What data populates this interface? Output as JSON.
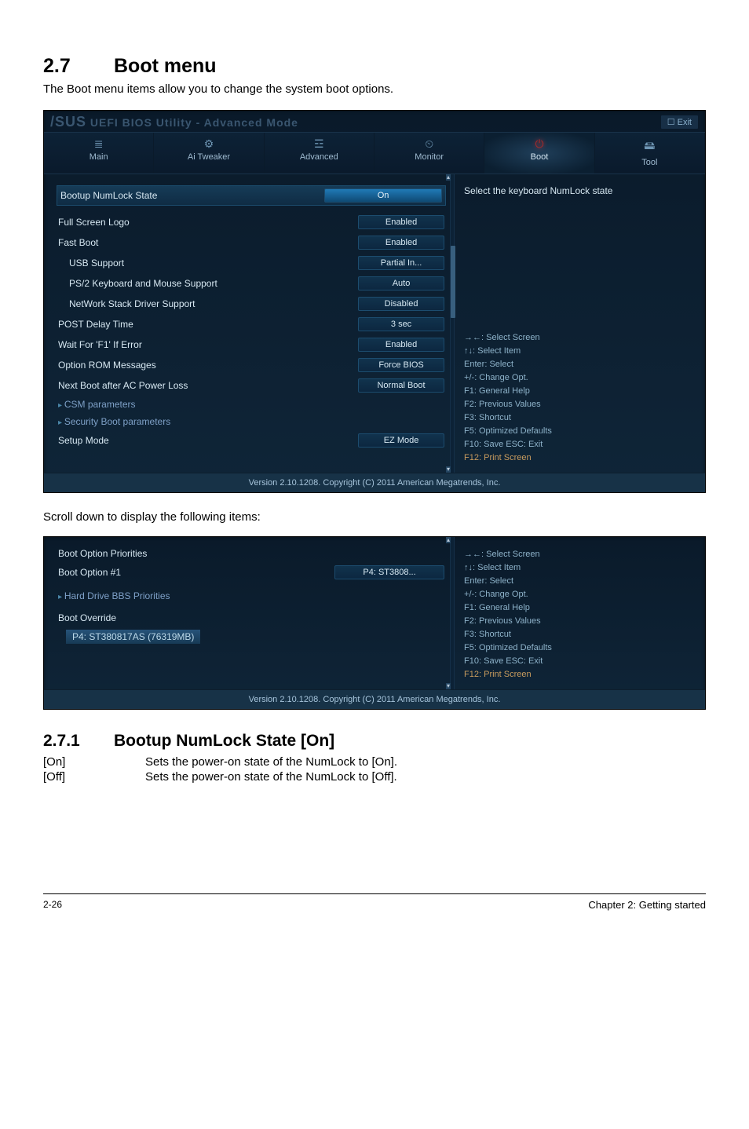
{
  "section": {
    "num": "2.7",
    "title": "Boot menu"
  },
  "intro": "The Boot menu items allow you to change the system boot options.",
  "bios1": {
    "brand_prefix": "/SUS",
    "brand_rest": " UEFI BIOS Utility - Advanced Mode",
    "exit": "Exit",
    "tabs": [
      {
        "icon": "≣",
        "label": "Main"
      },
      {
        "icon": "⚙",
        "label": "Ai Tweaker"
      },
      {
        "icon": "☲",
        "label": "Advanced"
      },
      {
        "icon": "⏲",
        "label": "Monitor"
      },
      {
        "icon": "⏻",
        "label": "Boot"
      },
      {
        "icon": "🖴",
        "label": "Tool"
      }
    ],
    "rows": {
      "numlock": {
        "label": "Bootup NumLock State",
        "value": "On"
      },
      "fullscreen": {
        "label": "Full Screen Logo",
        "value": "Enabled"
      },
      "fastboot": {
        "label": "Fast Boot",
        "value": "Enabled"
      },
      "usb": {
        "label": "USB Support",
        "value": "Partial In..."
      },
      "ps2": {
        "label": "PS/2 Keyboard and Mouse Support",
        "value": "Auto"
      },
      "netstack": {
        "label": "NetWork Stack Driver Support",
        "value": "Disabled"
      },
      "postdelay": {
        "label": "POST Delay Time",
        "value": "3 sec"
      },
      "waitf1": {
        "label": "Wait For 'F1' If Error",
        "value": "Enabled"
      },
      "optrom": {
        "label": "Option ROM Messages",
        "value": "Force BIOS"
      },
      "nextboot": {
        "label": "Next Boot after AC Power Loss",
        "value": "Normal Boot"
      },
      "csm": {
        "label": "CSM parameters"
      },
      "security": {
        "label": "Security Boot parameters"
      },
      "setupmode": {
        "label": "Setup Mode",
        "value": "EZ Mode"
      }
    },
    "right_desc": "Select the keyboard NumLock state",
    "help": {
      "l1": "→←: Select Screen",
      "l2": "↑↓: Select Item",
      "l3": "Enter: Select",
      "l4": "+/-: Change Opt.",
      "l5": "F1: General Help",
      "l6": "F2: Previous Values",
      "l7": "F3: Shortcut",
      "l8": "F5: Optimized Defaults",
      "l9": "F10: Save   ESC: Exit",
      "l10": "F12: Print Screen"
    },
    "footer": "Version 2.10.1208. Copyright (C) 2011 American Megatrends, Inc."
  },
  "scroll_note": "Scroll down to display the following items:",
  "bios2": {
    "bootopt_header": "Boot Option Priorities",
    "bootopt1": {
      "label": "Boot Option #1",
      "value": "P4: ST3808..."
    },
    "harddrive": "Hard Drive BBS Priorities",
    "override": "Boot Override",
    "p4": "P4: ST380817AS   (76319MB)",
    "help": {
      "l1": "→←: Select Screen",
      "l2": "↑↓: Select Item",
      "l3": "Enter: Select",
      "l4": "+/-: Change Opt.",
      "l5": "F1: General Help",
      "l6": "F2: Previous Values",
      "l7": "F3: Shortcut",
      "l8": "F5: Optimized Defaults",
      "l9": "F10: Save   ESC: Exit",
      "l10": "F12: Print Screen"
    },
    "footer": "Version 2.10.1208. Copyright (C) 2011 American Megatrends, Inc."
  },
  "subsection": {
    "num": "2.7.1",
    "title": "Bootup NumLock State [On]"
  },
  "opts": {
    "on": {
      "key": "[On]",
      "desc": "Sets the power-on state of the NumLock to [On]."
    },
    "off": {
      "key": "[Off]",
      "desc": "Sets the power-on state of the NumLock to [Off]."
    }
  },
  "pagefooter": {
    "left": "2-26",
    "right": "Chapter 2: Getting started"
  }
}
